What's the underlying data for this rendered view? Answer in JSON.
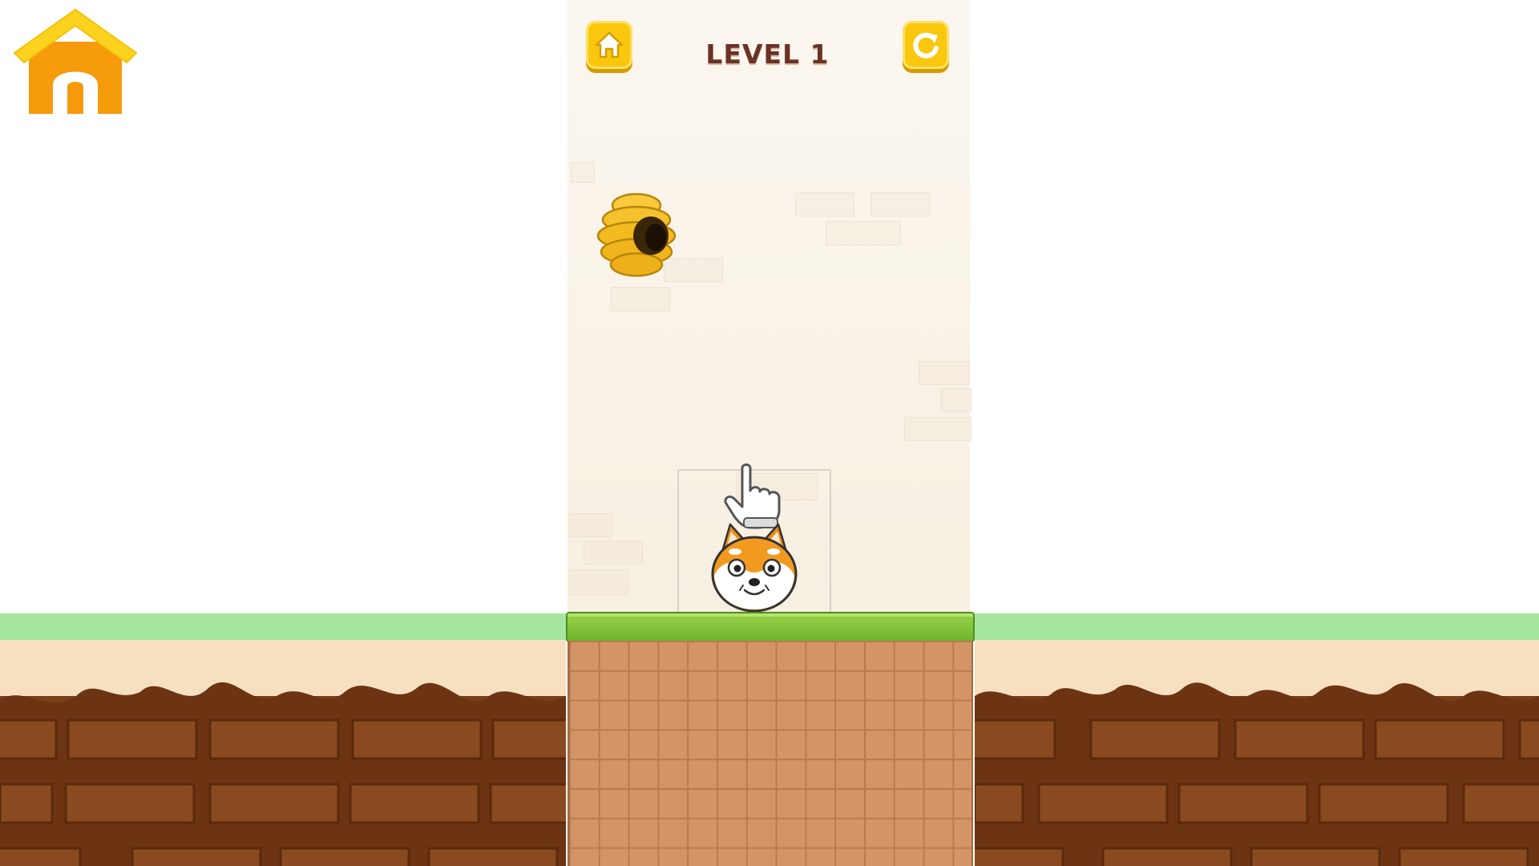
{
  "hud": {
    "level_title": "LEVEL 1",
    "home_icon": "home-icon",
    "restart_icon": "restart-icon"
  },
  "corner": {
    "icon": "house-icon"
  },
  "scene": {
    "beehive_icon": "beehive-icon",
    "hand_icon": "pointing-hand-icon",
    "dog_icon": "shiba-dog-icon"
  },
  "colors": {
    "button_yellow": "#f9c80e",
    "title_brown": "#6b3226",
    "grass_green": "#7cc135",
    "house_orange": "#f59b0c"
  }
}
